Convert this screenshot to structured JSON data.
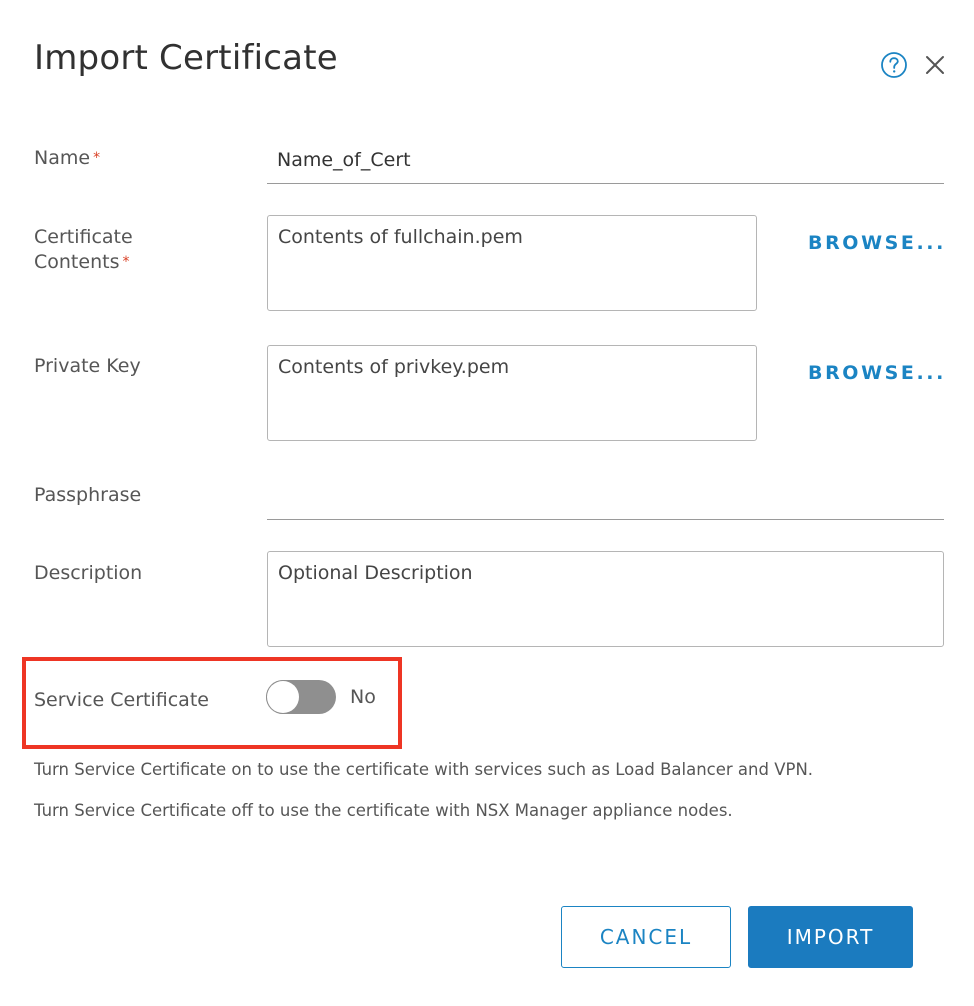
{
  "dialog": {
    "title": "Import Certificate",
    "icons": {
      "help": "help-circle-icon",
      "close": "close-icon"
    }
  },
  "form": {
    "name": {
      "label": "Name",
      "required_mark": "*",
      "value": "Name_of_Cert"
    },
    "certificate_contents": {
      "label_line1": "Certificate",
      "label_line2": "Contents",
      "required_mark": "*",
      "placeholder": "Contents of fullchain.pem",
      "browse_label": "BROWSE..."
    },
    "private_key": {
      "label": "Private Key",
      "placeholder": "Contents of privkey.pem",
      "browse_label": "BROWSE..."
    },
    "passphrase": {
      "label": "Passphrase",
      "value": ""
    },
    "description": {
      "label": "Description",
      "placeholder": "Optional Description"
    },
    "service_certificate": {
      "label": "Service Certificate",
      "enabled": false,
      "state_text": "No"
    }
  },
  "help_text": {
    "line1": "Turn Service Certificate on to use the certificate with services such as Load Balancer and VPN.",
    "line2": "Turn Service Certificate off to use the certificate with NSX Manager appliance nodes."
  },
  "buttons": {
    "cancel": "CANCEL",
    "import": "IMPORT"
  },
  "colors": {
    "accent": "#1b84c3",
    "primary_button": "#1b7bbf",
    "required": "#d94126",
    "highlight": "#ee3524",
    "toggle_off": "#8f8f8f"
  }
}
